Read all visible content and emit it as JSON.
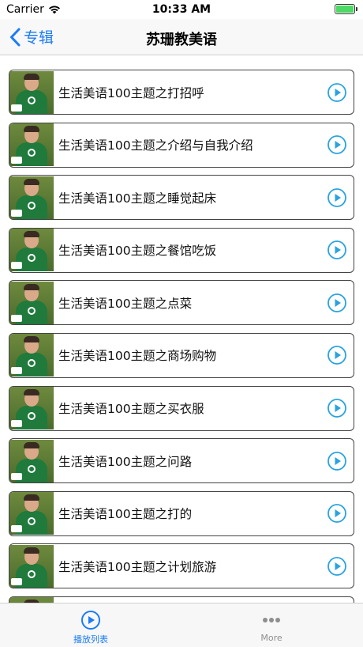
{
  "status_bar": {
    "carrier": "Carrier",
    "time": "10:33 AM"
  },
  "nav": {
    "back_label": "专辑",
    "title": "苏珊教美语"
  },
  "list": {
    "items": [
      {
        "title": "生活美语100主题之打招呼"
      },
      {
        "title": "生活美语100主题之介绍与自我介绍"
      },
      {
        "title": "生活美语100主题之睡觉起床"
      },
      {
        "title": "生活美语100主题之餐馆吃饭"
      },
      {
        "title": "生活美语100主题之点菜"
      },
      {
        "title": "生活美语100主题之商场购物"
      },
      {
        "title": "生活美语100主题之买衣服"
      },
      {
        "title": "生活美语100主题之问路"
      },
      {
        "title": "生活美语100主题之打的"
      },
      {
        "title": "生活美语100主题之计划旅游"
      },
      {
        "title": ""
      }
    ]
  },
  "tab_bar": {
    "tabs": [
      {
        "label": "播放列表",
        "icon": "play-circle-icon",
        "active": true
      },
      {
        "label": "More",
        "icon": "more-dots-icon",
        "active": false
      }
    ]
  },
  "colors": {
    "accent": "#1a7cf5",
    "play_icon": "#29a3e0"
  }
}
